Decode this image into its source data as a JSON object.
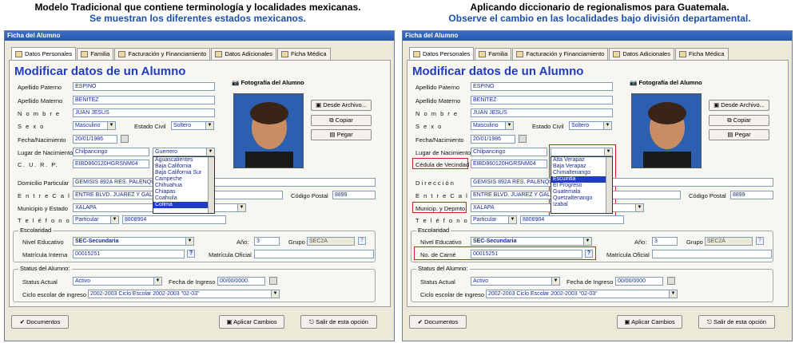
{
  "captions": {
    "left": {
      "line1": "Modelo Tradicional que contiene terminología y localidades mexicanas.",
      "line2": "Se muestran los diferentes estados mexicanos."
    },
    "right": {
      "line1": "Aplicando diccionario de regionalismos para Guatemala.",
      "line2": "Observe el cambio en las localidades bajo división departamental."
    }
  },
  "window_title": "Ficha del Alumno",
  "tabs": [
    "Datos Personales",
    "Familia",
    "Facturación y Financiamiento",
    "Datos Adicionales",
    "Ficha Médica"
  ],
  "heading": "Modificar datos de un Alumno",
  "labels": {
    "apellido_paterno": "Apellido Paterno",
    "apellido_materno": "Apellido Materno",
    "nombre": "N o m b r e",
    "sexo": "S e x o",
    "estado_civil": "Estado Civil",
    "fecha_nacimiento": "Fecha/Nacimiento",
    "lugar_nacimiento": "Lugar de Nacimiento",
    "curp": "C. U. R. P.",
    "cedula": "Cédula de Vecindad",
    "domicilio": "Domicilio Particular",
    "direccion": "D i r e c c i ó n",
    "entre_calles": "E n t r e  C a l l e s",
    "codigo_postal": "Código Postal",
    "municipio_estado": "Municipio y Estado",
    "municipio_depto": "Municip. y Depmto.",
    "telefono": "T e l é f o n o  (s)",
    "escolaridad": "Escolaridad",
    "nivel_educativo": "Nivel Educativo",
    "anio": "Año:",
    "grupo": "Grupo",
    "matricula_interna": "Matrícula Interna",
    "no_carne": "No. de Carné",
    "matricula_oficial": "Matrícula Oficial",
    "status": "Status del Alumno:",
    "status_actual": "Status Actual",
    "fecha_ingreso": "Fecha de Ingreso",
    "ciclo_escolar": "Ciclo escolar de ingreso",
    "foto": "Fotografía del Alumno"
  },
  "values": {
    "apellido_paterno": "ESPINO",
    "apellido_materno": "BENITEZ",
    "nombre": "JUAN JESUS",
    "sexo": "Masculino",
    "estado_civil": "Soltero",
    "fecha_nacimiento": "20/01/1986",
    "lugar_nacimiento": "Chilpancingo",
    "estado": "Guerrero",
    "curp": "EIBD860120HGRSNM04",
    "domicilio": "GEMISIS 892A RES. PALENQUE",
    "entre_calles": "ENTRE BLVD. JUAREZ Y GALEANA",
    "codigo_postal": "8899",
    "municipio": "XALAPA",
    "telefono_tipo": "Particular",
    "telefono": "8808904",
    "nivel_educativo": "SEC-Secundaria",
    "anio": "3",
    "grupo": "SEC2A",
    "matricula_interna": "00015251",
    "status_actual": "Activo",
    "fecha_ingreso": "00/00/0000",
    "ciclo_escolar": "2002-2003 Ciclo Escolar 2002-2003 \"02-03\""
  },
  "buttons": {
    "desde_archivo": "Desde Archivo...",
    "copiar": "Copiar",
    "pegar": "Pegar",
    "documentos": "Documentos",
    "aplicar": "Aplicar Cambios",
    "salir": "Salir de esta opción"
  },
  "dropdown_left": [
    "Aguascalientes",
    "Baja California",
    "Baja California Sur",
    "Campeche",
    "Chihuahua",
    "Chiapas",
    "Coahuila",
    "Colima"
  ],
  "dropdown_right": [
    "Alta Verapaz",
    "Baja Verapaz",
    "Chimaltenango",
    "Escuintla",
    "El Progreso",
    "Guatemala",
    "Quetzaltenango",
    "Izabal"
  ],
  "accent": "#1f3dbf",
  "highlight": "#d42020"
}
